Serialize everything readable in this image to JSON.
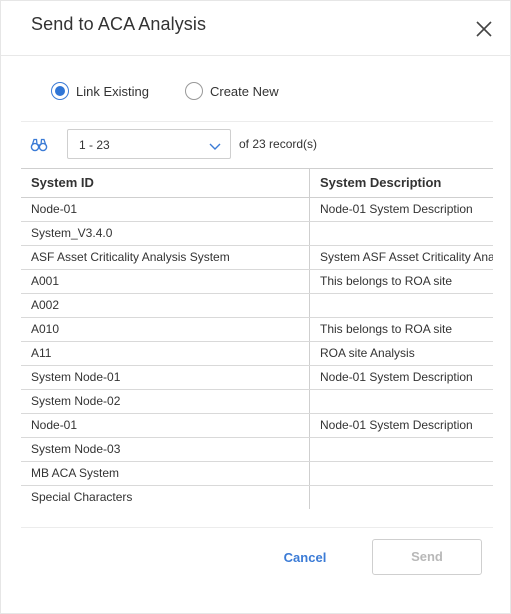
{
  "dialog": {
    "title": "Send to ACA Analysis"
  },
  "mode": {
    "options": [
      {
        "label": "Link Existing",
        "checked": true
      },
      {
        "label": "Create New",
        "checked": false
      }
    ]
  },
  "pager": {
    "range": "1 - 23",
    "of_text": "of  23  record(s)",
    "search_icon": "binoculars-icon",
    "dropdown_icon": "chevron-down-icon"
  },
  "grid": {
    "columns": [
      "System ID",
      "System Description"
    ],
    "rows": [
      {
        "id": "Node-01",
        "desc": "Node-01 System Description"
      },
      {
        "id": "System_V3.4.0",
        "desc": ""
      },
      {
        "id": "ASF Asset Criticality Analysis System",
        "desc": "System ASF Asset Criticality Analysis"
      },
      {
        "id": "A001",
        "desc": "This belongs to ROA site"
      },
      {
        "id": "A002",
        "desc": ""
      },
      {
        "id": "A010",
        "desc": "This belongs to ROA site"
      },
      {
        "id": "A11",
        "desc": "ROA site Analysis"
      },
      {
        "id": "System Node-01",
        "desc": "Node-01 System Description"
      },
      {
        "id": "System Node-02",
        "desc": ""
      },
      {
        "id": "Node-01",
        "desc": "Node-01 System Description"
      },
      {
        "id": "System Node-03",
        "desc": ""
      },
      {
        "id": "MB ACA System",
        "desc": ""
      },
      {
        "id": "Special Characters",
        "desc": ""
      }
    ]
  },
  "footer": {
    "cancel_label": "Cancel",
    "send_label": "Send"
  },
  "colors": {
    "accent": "#3b7bd6",
    "disabled_text": "#b8b8b8",
    "border": "#cfcfcf"
  }
}
